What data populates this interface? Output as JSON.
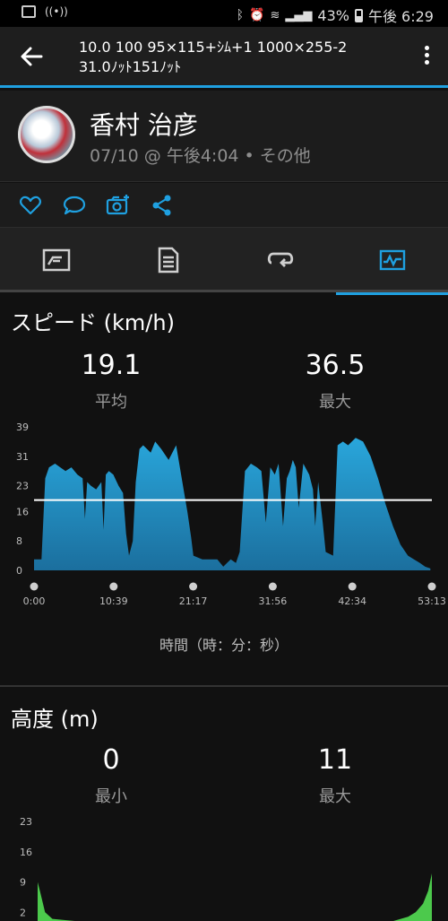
{
  "status_bar": {
    "battery": "43%",
    "time": "午後 6:29"
  },
  "header": {
    "title": "10.0 100 95×115+ｼﾑ+1 1000×255-2\n31.0ﾉｯﾄ151ﾉｯﾄ"
  },
  "profile": {
    "name": "香村 治彦",
    "meta": "07/10 @ 午後4:04 • その他"
  },
  "speed": {
    "title": "スピード (km/h)",
    "avg_value": "19.1",
    "avg_label": "平均",
    "max_value": "36.5",
    "max_label": "最大",
    "axis_caption": "時間（時：分：秒）"
  },
  "altitude": {
    "title": "高度 (m)",
    "min_value": "0",
    "min_label": "最小",
    "max_value": "11",
    "max_label": "最大"
  },
  "colors": {
    "accent": "#1fa0e0",
    "speed_fill": "#29a6db",
    "altitude_fill": "#4cc94c"
  },
  "chart_data": [
    {
      "type": "area",
      "title": "スピード (km/h)",
      "xlabel": "時間（時：分：秒）",
      "x_ticks": [
        "0:00",
        "10:39",
        "21:17",
        "31:56",
        "42:34",
        "53:13"
      ],
      "y_ticks": [
        0,
        8,
        16,
        23,
        31,
        39
      ],
      "ylim": [
        0,
        39
      ],
      "xlim_minutes": [
        0,
        53.2
      ],
      "average_line": 19.1,
      "x": [
        0,
        1,
        1.5,
        2,
        2.8,
        3.5,
        4.2,
        5,
        5.8,
        6.5,
        6.8,
        7.1,
        7.6,
        8.3,
        9,
        9.3,
        9.6,
        10,
        10.6,
        11.3,
        11.9,
        12.3,
        12.7,
        13.2,
        13.6,
        14.1,
        14.6,
        15.1,
        15.6,
        16.2,
        17,
        18,
        19,
        20,
        20.5,
        21,
        21.3,
        22.5,
        24.5,
        25.3,
        26.3,
        27,
        27.5,
        28.2,
        29,
        29.8,
        30.4,
        31,
        31.6,
        32.2,
        32.7,
        33.3,
        33.8,
        34.2,
        34.6,
        35,
        35.4,
        36,
        36.8,
        37.3,
        37.6,
        38,
        38.6,
        39,
        40,
        40.6,
        41.3,
        42,
        43,
        44,
        45,
        46,
        47,
        48,
        49,
        50,
        50.8,
        51.6,
        52.3,
        53
      ],
      "values": [
        3,
        3,
        25,
        28,
        29,
        28,
        27,
        28,
        26,
        25,
        14,
        24,
        23,
        22,
        24,
        11,
        26,
        27,
        26,
        23,
        21,
        10,
        4,
        8,
        24,
        33,
        34,
        33,
        32,
        35,
        33,
        30,
        34,
        22,
        16,
        9,
        4,
        3,
        3,
        1,
        3,
        2,
        5,
        27,
        29,
        28,
        27,
        13,
        28,
        26,
        29,
        12,
        25,
        27,
        30,
        28,
        17,
        29,
        26,
        22,
        12,
        24,
        13,
        5,
        4,
        34,
        35,
        34,
        36,
        35,
        31,
        25,
        18,
        12,
        7,
        4,
        3,
        2,
        1,
        0.5
      ]
    },
    {
      "type": "area",
      "title": "高度 (m)",
      "y_ticks": [
        2,
        9,
        16,
        23
      ],
      "ylim": [
        0,
        23
      ],
      "xlim_minutes": [
        0,
        53.2
      ],
      "x": [
        0,
        0.3,
        1,
        2,
        5,
        10,
        20,
        30,
        40,
        48,
        50,
        51,
        52,
        52.7,
        53.2
      ],
      "values": [
        9,
        7,
        2,
        0.5,
        0,
        0,
        0,
        0,
        0,
        0,
        1,
        2,
        4,
        7,
        11
      ]
    }
  ]
}
